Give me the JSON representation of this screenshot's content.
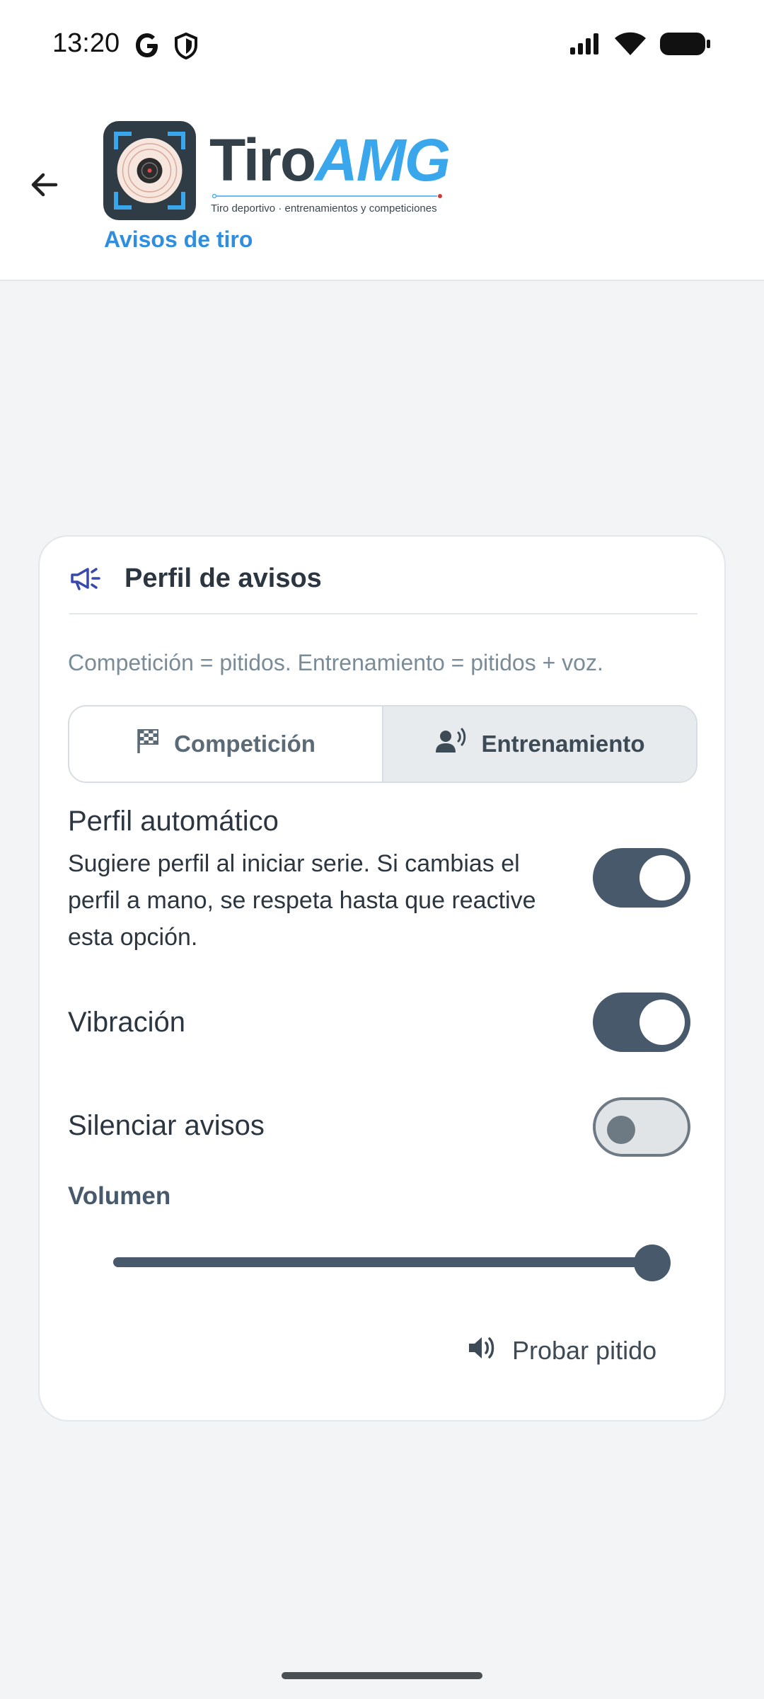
{
  "status_bar": {
    "time": "13:20",
    "icons": [
      "google-icon",
      "shield-icon",
      "signal-icon",
      "wifi-icon",
      "battery-icon"
    ]
  },
  "app_bar": {
    "logo_text_1": "Tiro",
    "logo_text_2": "AMG",
    "logo_tagline": "Tiro deportivo · entrenamientos y competiciones",
    "subtitle": "Avisos de tiro"
  },
  "card": {
    "title": "Perfil de avisos",
    "description": "Competición = pitidos. Entrenamiento = pitidos + voz.",
    "segments": [
      {
        "label": "Competición",
        "icon": "checkered-flag-icon",
        "selected": false
      },
      {
        "label": "Entrenamiento",
        "icon": "person-voice-icon",
        "selected": true
      }
    ],
    "settings": {
      "auto_profile": {
        "title": "Perfil automático",
        "description": "Sugiere perfil al iniciar serie. Si cambias el perfil a mano, se respeta hasta que reactive esta opción.",
        "enabled": true
      },
      "vibration": {
        "title": "Vibración",
        "enabled": true
      },
      "mute": {
        "title": "Silenciar avisos",
        "enabled": false
      }
    },
    "volume": {
      "label": "Volumen",
      "level": 1.0
    },
    "test_button": {
      "label": "Probar pitido",
      "icon": "volume-icon"
    }
  },
  "colors": {
    "accent": "#47596a",
    "brand_blue": "#3aa6ec",
    "subtitle_blue": "#2f8ee0",
    "background": "#f2f4f6"
  }
}
